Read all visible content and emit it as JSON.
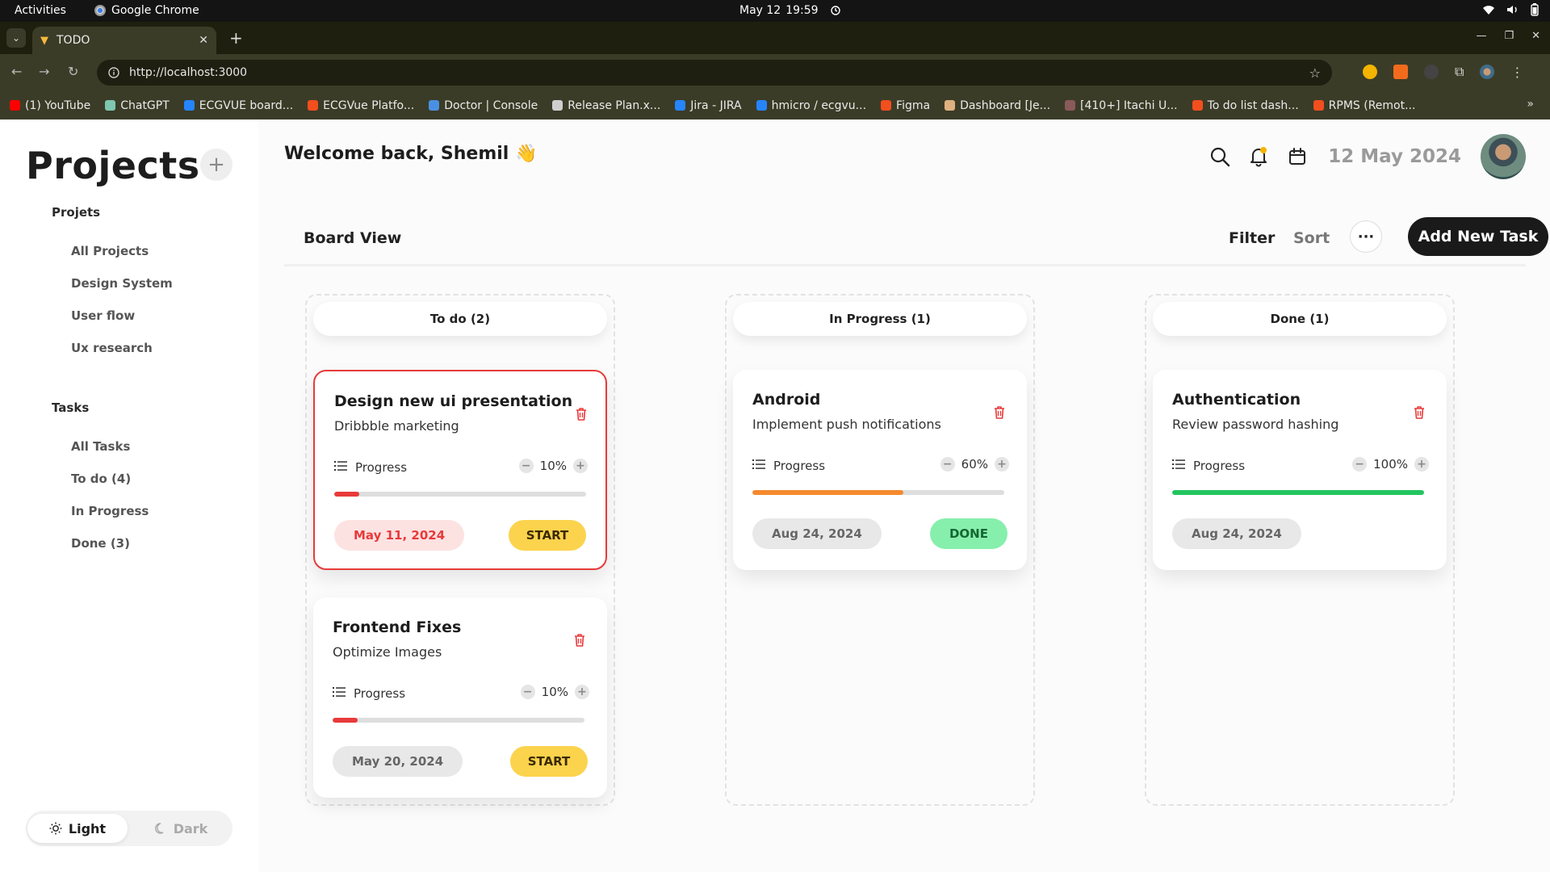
{
  "os": {
    "activities": "Activities",
    "app_name": "Google Chrome",
    "date": "May 12",
    "time": "19:59"
  },
  "browser": {
    "tab_title": "TODO",
    "url": "http://localhost:3000",
    "bookmarks": [
      {
        "label": "(1) YouTube",
        "color": "#ff0000"
      },
      {
        "label": "ChatGPT",
        "color": "#7fc6b0"
      },
      {
        "label": "ECGVUE board...",
        "color": "#2684ff"
      },
      {
        "label": "ECGVue Platfo...",
        "color": "#f24e1e"
      },
      {
        "label": "Doctor | Console",
        "color": "#4a90e2"
      },
      {
        "label": "Release Plan.x...",
        "color": "#cfcfcf"
      },
      {
        "label": "Jira - JIRA",
        "color": "#2684ff"
      },
      {
        "label": "hmicro / ecgvu...",
        "color": "#2684ff"
      },
      {
        "label": "Figma",
        "color": "#f24e1e"
      },
      {
        "label": "Dashboard [Je...",
        "color": "#e0b080"
      },
      {
        "label": "[410+] Itachi U...",
        "color": "#8a5a5a"
      },
      {
        "label": "To do list dash...",
        "color": "#f24e1e"
      },
      {
        "label": "RPMS (Remot...",
        "color": "#f24e1e"
      }
    ]
  },
  "sidebar": {
    "title": "Projects",
    "projects_heading": "Projets",
    "projects": [
      "All Projects",
      "Design System",
      "User flow",
      "Ux research"
    ],
    "tasks_heading": "Tasks",
    "tasks": [
      "All Tasks",
      "To do (4)",
      "In Progress",
      "Done (3)"
    ],
    "theme": {
      "light": "Light",
      "dark": "Dark"
    }
  },
  "header": {
    "welcome": "Welcome back, Shemil 👋",
    "date": "12 May 2024"
  },
  "toolbar": {
    "board_view": "Board View",
    "filter": "Filter",
    "sort": "Sort",
    "more": "···",
    "add_task": "Add New Task"
  },
  "columns": [
    {
      "title": "To do (2)",
      "cards": [
        {
          "title": "Design new ui presentation",
          "subtitle": "Dribbble marketing",
          "progress_label": "Progress",
          "progress": 10,
          "progress_text": "10%",
          "bar_color": "#e83a3a",
          "date": "May 11, 2024",
          "date_style": "overdue",
          "action": "START"
        },
        {
          "title": "Frontend Fixes",
          "subtitle": "Optimize Images",
          "progress_label": "Progress",
          "progress": 10,
          "progress_text": "10%",
          "bar_color": "#e83a3a",
          "date": "May 20, 2024",
          "date_style": "normal",
          "action": "START"
        }
      ]
    },
    {
      "title": "In Progress (1)",
      "cards": [
        {
          "title": "Android",
          "subtitle": "Implement push notifications",
          "progress_label": "Progress",
          "progress": 60,
          "progress_text": "60%",
          "bar_color": "#f5892e",
          "date": "Aug 24, 2024",
          "date_style": "normal",
          "action": "DONE"
        }
      ]
    },
    {
      "title": "Done (1)",
      "cards": [
        {
          "title": "Authentication",
          "subtitle": "Review password hashing",
          "progress_label": "Progress",
          "progress": 100,
          "progress_text": "100%",
          "bar_color": "#22c55e",
          "date": "Aug 24, 2024",
          "date_style": "normal",
          "action": ""
        }
      ]
    }
  ],
  "colors": {
    "start_button": "#fcd34d",
    "done_button": "#86efac",
    "overdue_pill_bg": "#fde2e2",
    "overdue_pill_text": "#e83a3a",
    "normal_pill_bg": "#e8e8e8",
    "normal_pill_text": "#666666",
    "selected_border": "#e83a3a"
  }
}
